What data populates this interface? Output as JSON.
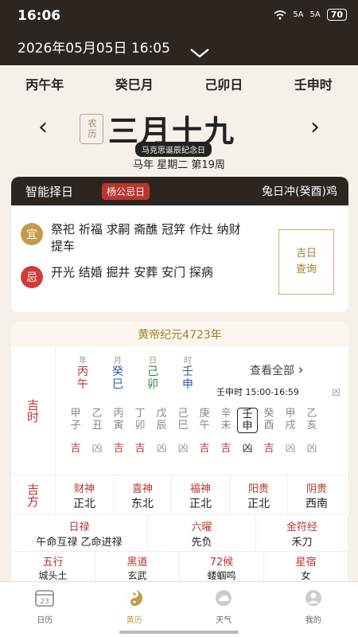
{
  "status": {
    "time": "16:06",
    "signal1": "5A",
    "signal2": "5A",
    "battery": "70"
  },
  "date_header": {
    "datetime": "2026年05月05日 16:05"
  },
  "ganzhi": [
    "丙午年",
    "癸巳月",
    "己卯日",
    "壬申时"
  ],
  "lunar": {
    "tag": "农历",
    "date": "三月十九",
    "festival": "马克思诞辰纪念日",
    "week_line": "马年 星期二 第19周"
  },
  "card_yiji": {
    "title": "智能择日",
    "god_day": "杨公忌日",
    "chong": "兔日冲(癸酉)鸡",
    "yi_label": "宜",
    "yi_text": "祭祀 祈福 求嗣 斋醮 冠笄 作灶 纳财 提车",
    "ji_label": "忌",
    "ji_text": "开光 结婚 掘井 安葬 安门 探病",
    "jiri_line1": "吉日",
    "jiri_line2": "查询",
    "colors": {
      "yi": "#c59a4a",
      "ji": "#d33a3a"
    }
  },
  "huangli": {
    "era": "黄帝纪元4723年",
    "jishi_label": "吉时",
    "pillars": [
      {
        "label": "年",
        "tg": "丙",
        "dz": "午",
        "color": "#b8362e"
      },
      {
        "label": "月",
        "tg": "癸",
        "dz": "巳",
        "color": "#2c58a8"
      },
      {
        "label": "日",
        "tg": "己",
        "dz": "卯",
        "color": "#2b8a3e"
      },
      {
        "label": "时",
        "tg": "壬",
        "dz": "申",
        "color": "#2c58a8"
      }
    ],
    "see_all": "查看全部",
    "current_shichen": "壬申时 15:00-16:59",
    "current_status": "凶",
    "shichen": [
      {
        "tg": "甲",
        "dz": "子",
        "ji": "吉",
        "active": false
      },
      {
        "tg": "乙",
        "dz": "丑",
        "ji": "凶",
        "active": false
      },
      {
        "tg": "丙",
        "dz": "寅",
        "ji": "吉",
        "active": false
      },
      {
        "tg": "丁",
        "dz": "卯",
        "ji": "吉",
        "active": false
      },
      {
        "tg": "戊",
        "dz": "辰",
        "ji": "凶",
        "active": false
      },
      {
        "tg": "己",
        "dz": "巳",
        "ji": "凶",
        "active": false
      },
      {
        "tg": "庚",
        "dz": "午",
        "ji": "吉",
        "active": false
      },
      {
        "tg": "辛",
        "dz": "未",
        "ji": "吉",
        "active": false
      },
      {
        "tg": "壬",
        "dz": "申",
        "ji": "凶",
        "active": true
      },
      {
        "tg": "癸",
        "dz": "酉",
        "ji": "吉",
        "active": false
      },
      {
        "tg": "甲",
        "dz": "戌",
        "ji": "凶",
        "active": false
      },
      {
        "tg": "乙",
        "dz": "亥",
        "ji": "凶",
        "active": false
      }
    ],
    "fang_label": "吉方",
    "fang": [
      {
        "name": "财神",
        "val": "正北"
      },
      {
        "name": "喜神",
        "val": "东北"
      },
      {
        "name": "福神",
        "val": "正北"
      },
      {
        "name": "阳贵",
        "val": "正北"
      },
      {
        "name": "阴贵",
        "val": "西南"
      }
    ],
    "row3": [
      {
        "name": "日禄",
        "val": "午命互禄 乙命进禄"
      },
      {
        "name": "六曜",
        "val": "先负"
      },
      {
        "name": "金符经",
        "val": "禾刀"
      }
    ],
    "row4": [
      {
        "name": "五行",
        "val": "城头土"
      },
      {
        "name": "黑道",
        "val": "玄武"
      },
      {
        "name": "72候",
        "val": "蝼蝈鸣"
      },
      {
        "name": "星宿",
        "val": "女"
      }
    ]
  },
  "tabs": [
    {
      "label": "日历",
      "icon": "calendar-icon",
      "active": false
    },
    {
      "label": "黄历",
      "icon": "yinyang-icon",
      "active": true
    },
    {
      "label": "天气",
      "icon": "weather-icon",
      "active": false
    },
    {
      "label": "我的",
      "icon": "profile-icon",
      "active": false
    }
  ]
}
